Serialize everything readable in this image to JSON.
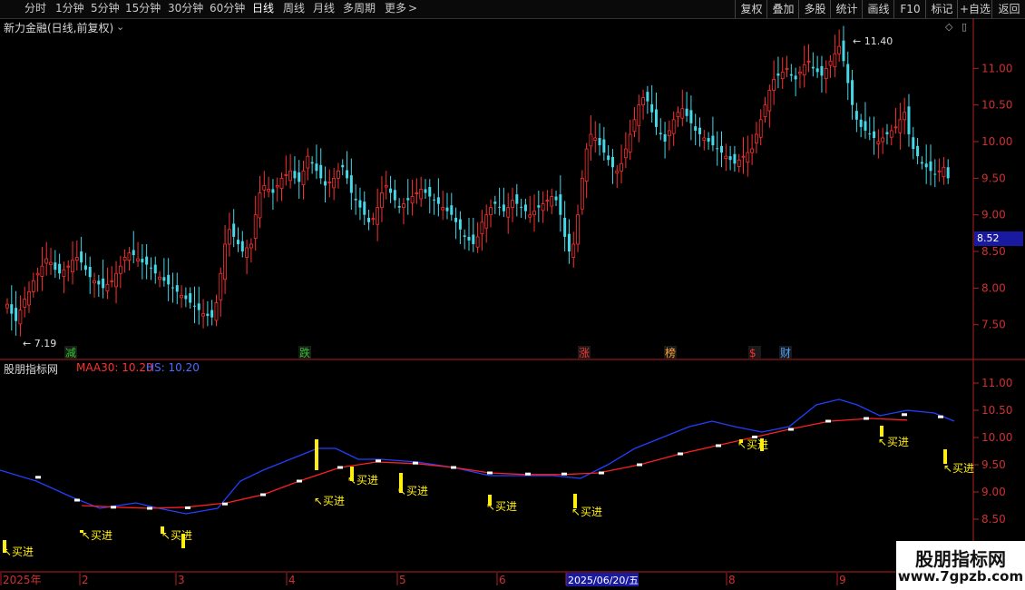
{
  "toolbar": {
    "periods": [
      "分时",
      "1分钟",
      "5分钟",
      "15分钟",
      "30分钟",
      "60分钟",
      "日线",
      "周线",
      "月线",
      "多周期",
      "更多"
    ],
    "active_period": "日线",
    "right_buttons": [
      "复权",
      "叠加",
      "多股",
      "统计",
      "画线",
      "F10",
      "标记",
      "+自选",
      "返回"
    ]
  },
  "stock": {
    "title": "新力金融(日线,前复权)",
    "last_price": "8.52",
    "high_label": "11.40",
    "low_label": "7.19"
  },
  "price_axis": [
    "11.00",
    "10.50",
    "10.00",
    "9.50",
    "9.00",
    "8.50",
    "8.00",
    "7.50"
  ],
  "event_tags": [
    {
      "text": "减",
      "color": "#29c429"
    },
    {
      "text": "跌",
      "color": "#29c429"
    },
    {
      "text": "涨",
      "color": "#ff3030"
    },
    {
      "text": "榜",
      "color": "#ffa030"
    },
    {
      "text": "$",
      "color": "#ff3030"
    },
    {
      "text": "财",
      "color": "#4aa0ff"
    }
  ],
  "indicator": {
    "name": "股朋指标网",
    "maa_label": "MAA30: 10.20",
    "hs_label": "HS: 10.20",
    "axis": [
      "11.00",
      "10.50",
      "10.00",
      "9.50",
      "9.00",
      "8.50",
      "8.00"
    ],
    "buy_label": "买进"
  },
  "time_axis": [
    "2025年",
    "2",
    "3",
    "4",
    "5",
    "6",
    "2025/06/20/五",
    "8",
    "9"
  ],
  "watermark": {
    "title": "股朋指标网",
    "url": "www.7gpzb.com"
  },
  "chart_data": {
    "type": "candlestick",
    "ylim": [
      7.1,
      11.5
    ],
    "closes": [
      7.78,
      7.65,
      7.55,
      7.7,
      7.85,
      7.95,
      8.1,
      8.2,
      8.3,
      8.4,
      8.35,
      8.25,
      8.2,
      8.25,
      8.3,
      8.38,
      8.42,
      8.35,
      8.25,
      8.15,
      8.1,
      8.05,
      8.0,
      8.05,
      8.1,
      8.2,
      8.3,
      8.42,
      8.48,
      8.45,
      8.4,
      8.35,
      8.32,
      8.28,
      8.2,
      8.15,
      8.1,
      8.05,
      8.0,
      7.95,
      7.9,
      7.85,
      7.8,
      7.75,
      7.7,
      7.65,
      7.62,
      7.6,
      7.8,
      8.2,
      8.6,
      8.8,
      8.7,
      8.6,
      8.5,
      8.55,
      8.6,
      9.0,
      9.3,
      9.4,
      9.35,
      9.3,
      9.4,
      9.5,
      9.55,
      9.6,
      9.5,
      9.45,
      9.6,
      9.8,
      9.7,
      9.6,
      9.5,
      9.4,
      9.45,
      9.5,
      9.6,
      9.65,
      9.5,
      9.3,
      9.2,
      9.1,
      9.0,
      8.9,
      8.95,
      9.1,
      9.3,
      9.4,
      9.3,
      9.2,
      9.1,
      9.15,
      9.2,
      9.25,
      9.3,
      9.35,
      9.3,
      9.25,
      9.2,
      9.15,
      9.1,
      9.05,
      9.0,
      8.9,
      8.8,
      8.7,
      8.65,
      8.6,
      8.7,
      8.9,
      9.0,
      9.1,
      9.15,
      9.1,
      9.05,
      9.1,
      9.2,
      9.15,
      9.1,
      9.05,
      9.0,
      9.05,
      9.1,
      9.15,
      9.2,
      9.25,
      9.2,
      9.0,
      8.7,
      8.5,
      8.6,
      9.0,
      9.5,
      9.9,
      10.1,
      10.05,
      9.95,
      9.85,
      9.75,
      9.65,
      9.6,
      9.7,
      9.9,
      10.1,
      10.3,
      10.5,
      10.6,
      10.55,
      10.4,
      10.2,
      10.1,
      10.0,
      10.15,
      10.3,
      10.4,
      10.45,
      10.35,
      10.25,
      10.15,
      10.1,
      10.05,
      10.0,
      9.95,
      9.9,
      9.85,
      9.8,
      9.75,
      9.7,
      9.75,
      9.8,
      9.85,
      9.9,
      10.1,
      10.3,
      10.5,
      10.7,
      10.85,
      10.9,
      10.95,
      11.0,
      10.9,
      10.85,
      10.95,
      11.05,
      11.1,
      11.0,
      10.95,
      10.9,
      11.0,
      11.1,
      11.2,
      11.3,
      11.1,
      10.8,
      10.5,
      10.3,
      10.2,
      10.15,
      10.1,
      10.05,
      10.0,
      10.05,
      10.1,
      10.15,
      10.2,
      10.3,
      10.4,
      10.1,
      9.9,
      9.8,
      9.7,
      9.65,
      9.6,
      9.55,
      9.6,
      9.65,
      9.5
    ]
  }
}
